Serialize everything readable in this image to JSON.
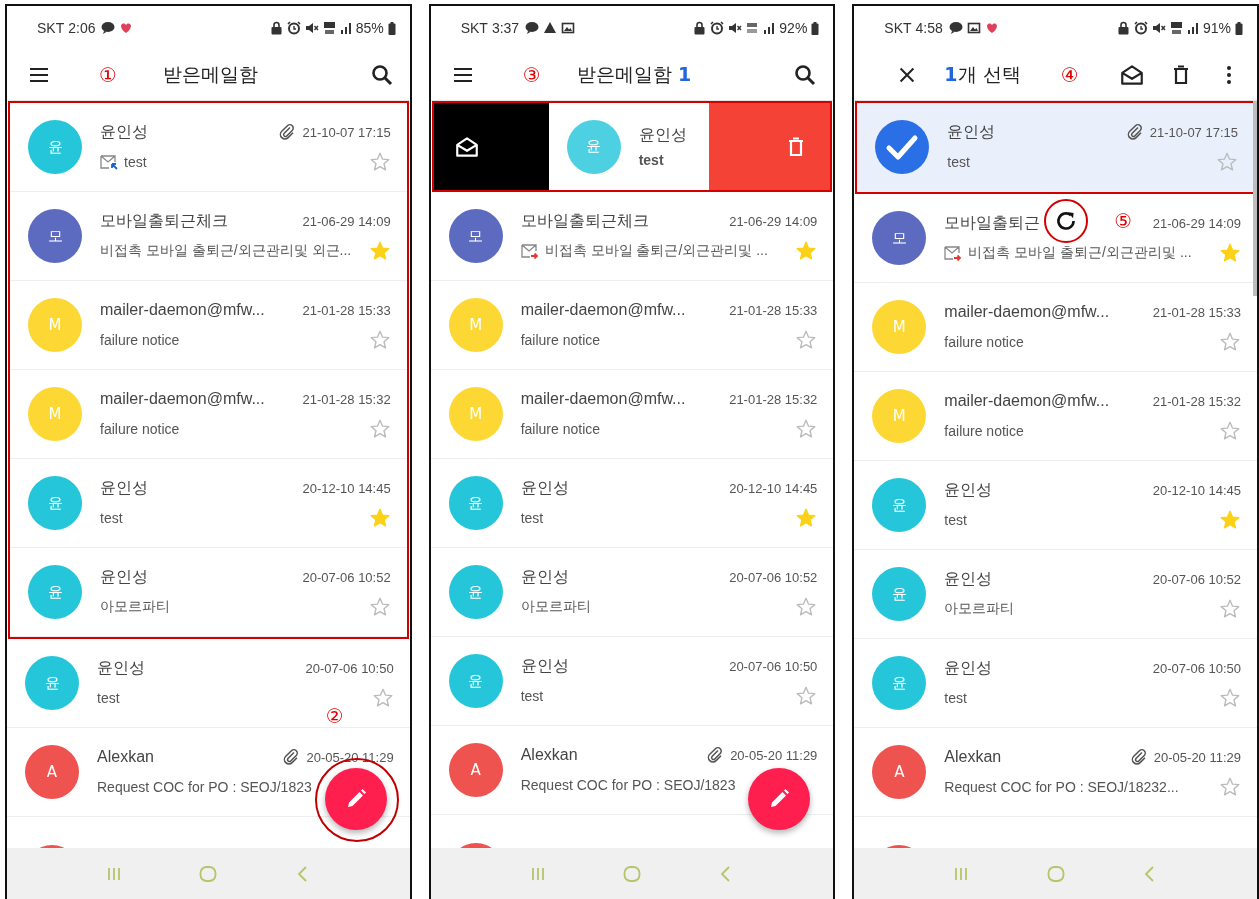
{
  "screens": [
    {
      "status": {
        "carrier": "SKT",
        "time": "2:06",
        "left_icons": [
          {
            "kind": "chat"
          },
          {
            "kind": "heart"
          }
        ],
        "network": {
          "kind": "nr"
        },
        "battery": "85%"
      },
      "header": {
        "kind": "inbox",
        "title": "받은메일함",
        "marker": "①"
      },
      "rows": [
        {
          "kind": "mail",
          "avatar": "윤",
          "color": "#26c6da",
          "sender": "윤인성",
          "attachment": true,
          "date": "21-10-07 17:15",
          "mail_icon": {
            "kind": "reply"
          },
          "subject": "test",
          "starred": false,
          "outlined": true
        },
        {
          "kind": "mail",
          "avatar": "모",
          "color": "#5c6bc0",
          "sender": "모바일출퇴근체크",
          "attachment": false,
          "date": "21-06-29 14:09",
          "subject": "비접촉 모바일 출퇴근/외근관리및 외근...",
          "starred": true,
          "outlined": true
        },
        {
          "kind": "mail",
          "avatar": "M",
          "color": "#fdd835",
          "sender": "mailer-daemon@mfw...",
          "attachment": false,
          "date": "21-01-28 15:33",
          "subject": "failure notice",
          "starred": false,
          "outlined": true
        },
        {
          "kind": "mail",
          "avatar": "M",
          "color": "#fdd835",
          "sender": "mailer-daemon@mfw...",
          "attachment": false,
          "date": "21-01-28 15:32",
          "subject": "failure notice",
          "starred": false,
          "outlined": true
        },
        {
          "kind": "mail",
          "avatar": "윤",
          "color": "#26c6da",
          "sender": "윤인성",
          "attachment": false,
          "date": "20-12-10 14:45",
          "subject": "test",
          "starred": true,
          "outlined": true
        },
        {
          "kind": "mail",
          "avatar": "윤",
          "color": "#26c6da",
          "sender": "윤인성",
          "attachment": false,
          "date": "20-07-06 10:52",
          "subject": "아모르파티",
          "starred": false,
          "outlined": true
        },
        {
          "kind": "mail",
          "avatar": "윤",
          "color": "#26c6da",
          "sender": "윤인성",
          "attachment": false,
          "date": "20-07-06 10:50",
          "subject": "test",
          "starred": false,
          "outlined": false
        },
        {
          "kind": "mail",
          "avatar": "A",
          "color": "#ef5350",
          "sender": "Alexkan",
          "attachment": true,
          "date": "20-05-20 11:29",
          "subject": "Request COC for PO : SEOJ/1823",
          "outlined": false
        },
        {
          "kind": "cut",
          "color": "#ef5350"
        }
      ],
      "fab": {
        "circled": true,
        "marker": "②"
      }
    },
    {
      "status": {
        "carrier": "SKT",
        "time": "3:37",
        "left_icons": [
          {
            "kind": "chat"
          },
          {
            "kind": "alert"
          },
          {
            "kind": "image"
          }
        ],
        "network": {
          "kind": "lte"
        },
        "battery": "92%"
      },
      "header": {
        "kind": "inbox",
        "title": "받은메일함",
        "count": "1",
        "marker": "③"
      },
      "rows": [
        {
          "kind": "swiped",
          "avatar": "윤",
          "color": "#4dd0e1",
          "sender": "윤인성",
          "subject": "test",
          "outlined": true
        },
        {
          "kind": "mail",
          "avatar": "모",
          "color": "#5c6bc0",
          "sender": "모바일출퇴근체크",
          "attachment": false,
          "date": "21-06-29 14:09",
          "mail_icon": {
            "kind": "forward"
          },
          "subject": "비접촉 모바일 출퇴근/외근관리및 ...",
          "starred": true,
          "outlined": false
        },
        {
          "kind": "mail",
          "avatar": "M",
          "color": "#fdd835",
          "sender": "mailer-daemon@mfw...",
          "attachment": false,
          "date": "21-01-28 15:33",
          "subject": "failure notice",
          "starred": false,
          "outlined": false
        },
        {
          "kind": "mail",
          "avatar": "M",
          "color": "#fdd835",
          "sender": "mailer-daemon@mfw...",
          "attachment": false,
          "date": "21-01-28 15:32",
          "subject": "failure notice",
          "starred": false,
          "outlined": false
        },
        {
          "kind": "mail",
          "avatar": "윤",
          "color": "#26c6da",
          "sender": "윤인성",
          "attachment": false,
          "date": "20-12-10 14:45",
          "subject": "test",
          "starred": true,
          "outlined": false
        },
        {
          "kind": "mail",
          "avatar": "윤",
          "color": "#26c6da",
          "sender": "윤인성",
          "attachment": false,
          "date": "20-07-06 10:52",
          "subject": "아모르파티",
          "starred": false,
          "outlined": false
        },
        {
          "kind": "mail",
          "avatar": "윤",
          "color": "#26c6da",
          "sender": "윤인성",
          "attachment": false,
          "date": "20-07-06 10:50",
          "subject": "test",
          "starred": false,
          "outlined": false
        },
        {
          "kind": "mail",
          "avatar": "A",
          "color": "#ef5350",
          "sender": "Alexkan",
          "attachment": true,
          "date": "20-05-20 11:29",
          "subject": "Request COC for PO : SEOJ/1823",
          "outlined": false
        },
        {
          "kind": "cut",
          "color": "#ef5350"
        }
      ],
      "fab": {
        "circled": false
      }
    },
    {
      "status": {
        "carrier": "SKT",
        "time": "4:58",
        "left_icons": [
          {
            "kind": "chat"
          },
          {
            "kind": "image"
          },
          {
            "kind": "heart"
          }
        ],
        "network": {
          "kind": "nr"
        },
        "battery": "91%"
      },
      "header": {
        "kind": "selection",
        "count": "1",
        "title": "개 선택",
        "marker": "④"
      },
      "rows": [
        {
          "kind": "mail",
          "selected": true,
          "sender": "윤인성",
          "attachment": true,
          "date": "21-10-07 17:15",
          "subject": "test",
          "starred": false,
          "outlined": true
        },
        {
          "kind": "mail",
          "selected": false,
          "avatar": "모",
          "color": "#5c6bc0",
          "sender": "모바일출퇴근",
          "attachment": false,
          "date": "21-06-29 14:09",
          "mail_icon": {
            "kind": "forward"
          },
          "subject": "비접촉 모바일 출퇴근/외근관리및 ...",
          "starred": true,
          "outlined": false
        },
        {
          "kind": "mail",
          "selected": false,
          "avatar": "M",
          "color": "#fdd835",
          "sender": "mailer-daemon@mfw...",
          "attachment": false,
          "date": "21-01-28 15:33",
          "subject": "failure notice",
          "starred": false,
          "outlined": false
        },
        {
          "kind": "mail",
          "selected": false,
          "avatar": "M",
          "color": "#fdd835",
          "sender": "mailer-daemon@mfw...",
          "attachment": false,
          "date": "21-01-28 15:32",
          "subject": "failure notice",
          "starred": false,
          "outlined": false
        },
        {
          "kind": "mail",
          "selected": false,
          "avatar": "윤",
          "color": "#26c6da",
          "sender": "윤인성",
          "attachment": false,
          "date": "20-12-10 14:45",
          "subject": "test",
          "starred": true,
          "outlined": false
        },
        {
          "kind": "mail",
          "selected": false,
          "avatar": "윤",
          "color": "#26c6da",
          "sender": "윤인성",
          "attachment": false,
          "date": "20-07-06 10:52",
          "subject": "아모르파티",
          "starred": false,
          "outlined": false
        },
        {
          "kind": "mail",
          "selected": false,
          "avatar": "윤",
          "color": "#26c6da",
          "sender": "윤인성",
          "attachment": false,
          "date": "20-07-06 10:50",
          "subject": "test",
          "starred": false,
          "outlined": false
        },
        {
          "kind": "mail",
          "selected": false,
          "avatar": "A",
          "color": "#ef5350",
          "sender": "Alexkan",
          "attachment": true,
          "date": "20-05-20 11:29",
          "subject": "Request COC for PO : SEOJ/18232...",
          "starred": false,
          "outlined": false
        },
        {
          "kind": "cut",
          "color": "#ef5350"
        }
      ],
      "refresh": {
        "circled": true,
        "marker": "⑤"
      }
    }
  ]
}
